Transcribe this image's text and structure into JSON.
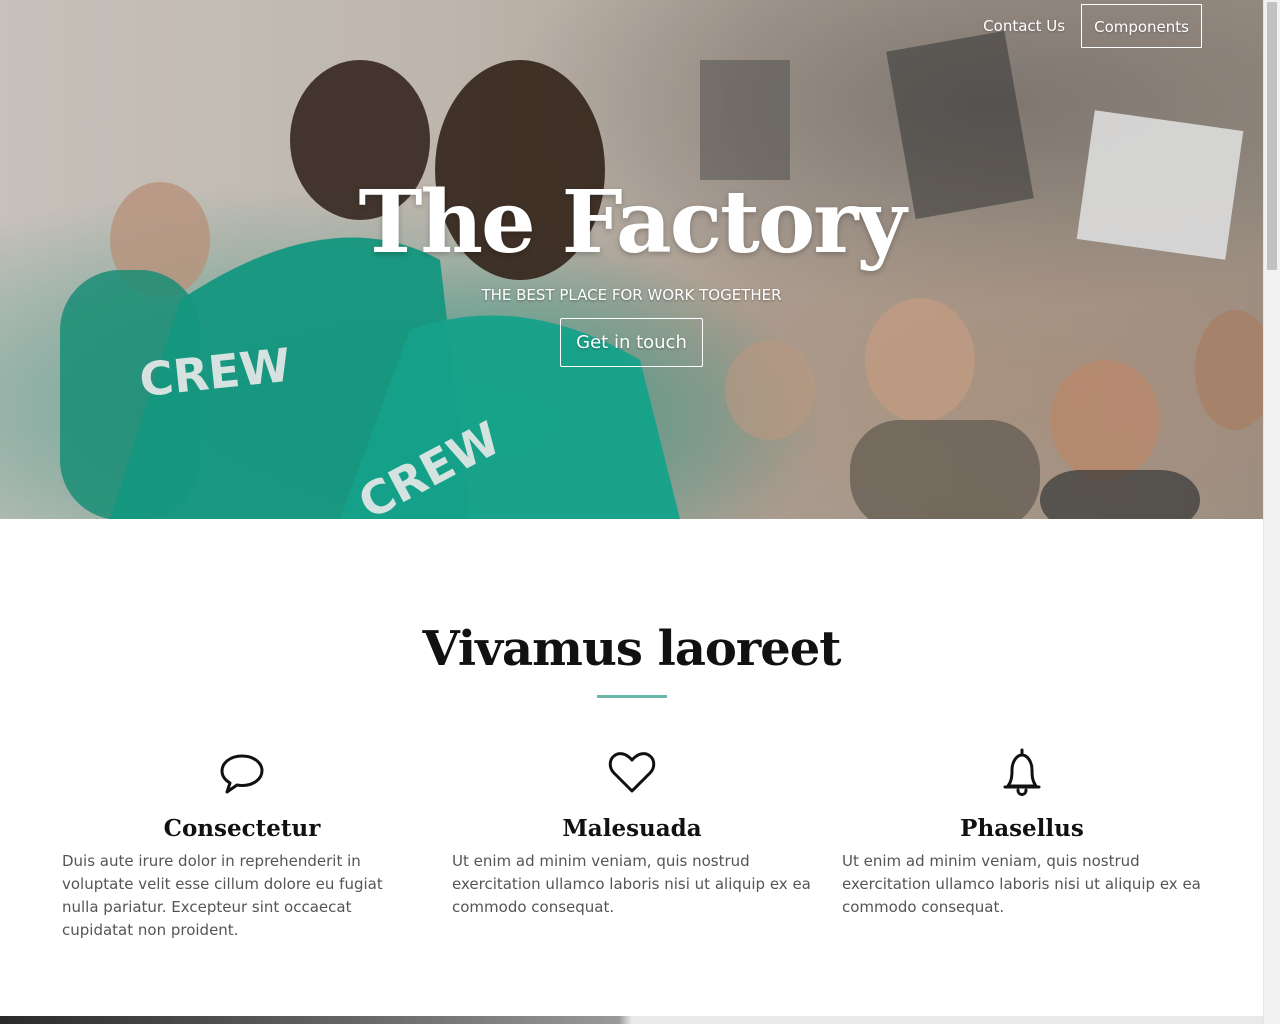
{
  "nav": {
    "contact_label": "Contact Us",
    "components_label": "Components"
  },
  "hero": {
    "title": "The Factory",
    "subtitle": "The best place for work together",
    "cta_label": "Get in touch"
  },
  "section": {
    "title": "Vivamus laoreet",
    "accent_color": "#6bb6aa"
  },
  "features": [
    {
      "icon": "speech-bubble-icon",
      "title": "Consectetur",
      "text": "Duis aute irure dolor in reprehenderit in voluptate velit esse cillum dolore eu fugiat nulla pariatur. Excepteur sint occaecat cupidatat non proident."
    },
    {
      "icon": "heart-icon",
      "title": "Malesuada",
      "text": "Ut enim ad minim veniam, quis nostrud exercitation ullamco laboris nisi ut aliquip ex ea commodo consequat."
    },
    {
      "icon": "bell-icon",
      "title": "Phasellus",
      "text": "Ut enim ad minim veniam, quis nostrud exercitation ullamco laboris nisi ut aliquip ex ea commodo consequat."
    }
  ]
}
